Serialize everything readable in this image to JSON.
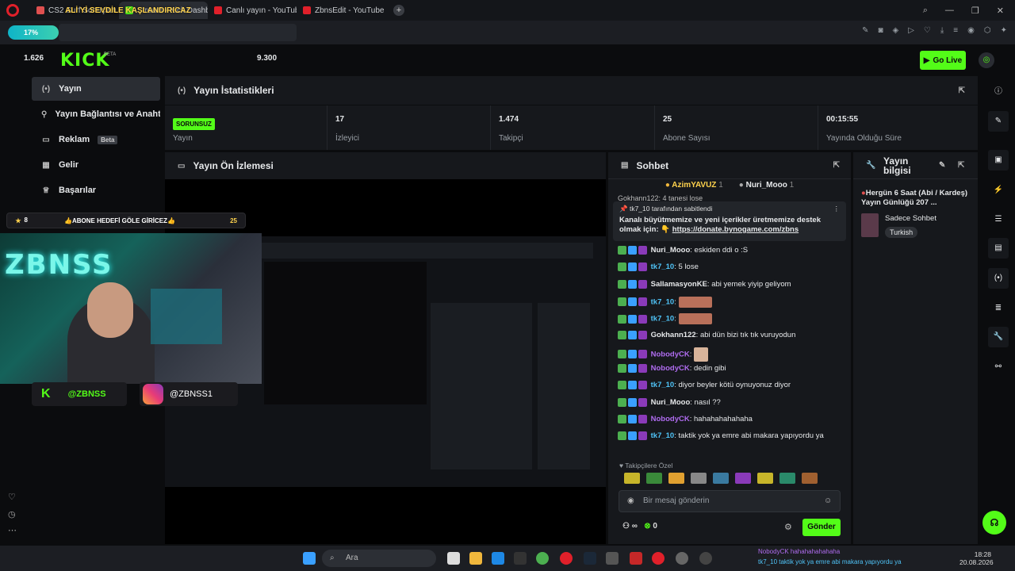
{
  "browser": {
    "tabs": [
      {
        "title": "CS2 Surf Sonuçları - xplo",
        "color": "#e05050"
      },
      {
        "title": "Stream - Kick Dashboard",
        "color": "#53fc18"
      },
      {
        "title": "Canlı yayın - YouTube Stu",
        "color": "#e0202a"
      },
      {
        "title": "ZbnsEdit - YouTube",
        "color": "#e0202a"
      }
    ],
    "banner_text": "ALİ Yİ SEVDİLE KAŞLANDIRICAZ",
    "progress_label": "17%"
  },
  "header": {
    "logo": "KICK",
    "logo_badge": "BETA",
    "left_count": "1.626",
    "right_count": "9.300",
    "go_live_label": "Go Live"
  },
  "sidebar": {
    "items": [
      {
        "label": "Yayın",
        "icon": "(•)",
        "active": true
      },
      {
        "label": "Yayın Bağlantısı ve Anahtarı",
        "icon": "⚲"
      },
      {
        "label": "Reklam",
        "icon": "▭",
        "badge": "Beta"
      },
      {
        "label": "Gelir",
        "icon": "▦"
      },
      {
        "label": "Başarılar",
        "icon": "♕"
      }
    ]
  },
  "overlay": {
    "goal_text": "👍ABONE HEDEFİ GÖLE GİRİCEZ👍",
    "goal_left": "8",
    "goal_right": "25",
    "neon_text": "ZBNSS",
    "kick_handle": "@ZBNSS",
    "ig_handle": "@ZBNSS1"
  },
  "stats": {
    "title": "Yayın İstatistikleri",
    "status_badge": "SORUNSUZ",
    "status_label": "Yayın",
    "viewers": "17",
    "viewers_label": "İzleyici",
    "followers": "1.474",
    "followers_label": "Takipçi",
    "subs": "25",
    "subs_label": "Abone Sayısı",
    "duration": "00:15:55",
    "duration_label": "Yayında Olduğu Süre"
  },
  "preview": {
    "title": "Yayın Ön İzlemesi"
  },
  "chat": {
    "title": "Sohbet",
    "top_gifters": [
      {
        "name": "AzimYAVUZ",
        "count": "1"
      },
      {
        "name": "Nuri_Mooo",
        "count": "1"
      }
    ],
    "cut_message": "Gokhann122: 4 tanesi lose",
    "pinned_by": "tk7_10 tarafından sabitlendi",
    "pinned_text": "Kanalı büyütmemize ve yeni içerikler üretmemize destek olmak için: 👇",
    "pinned_link": "https://donate.bynogame.com/zbns",
    "messages": [
      {
        "user": "Nuri_Mooo",
        "color": "#e6e8ea",
        "text": "eskiden ddi o :S"
      },
      {
        "user": "tk7_10",
        "color": "#4fc3f7",
        "text": "5 lose"
      },
      {
        "user": "SallamasyonKE",
        "color": "#e6e8ea",
        "text": "abi yemek yiyip geliyom"
      },
      {
        "user": "tk7_10",
        "color": "#4fc3f7",
        "text": "",
        "emote": true
      },
      {
        "user": "tk7_10",
        "color": "#4fc3f7",
        "text": "",
        "emote": true
      },
      {
        "user": "Gokhann122",
        "color": "#e6e8ea",
        "text": "abi dün bizi tık tık vuruyodun"
      },
      {
        "user": "NobodyCK",
        "color": "#b06cf0",
        "text": "",
        "emote_small": true
      },
      {
        "user": "NobodyCK",
        "color": "#b06cf0",
        "text": "dedin gibi"
      },
      {
        "user": "tk7_10",
        "color": "#4fc3f7",
        "text": "diyor beyler kötü oynuyonuz diyor"
      },
      {
        "user": "Nuri_Mooo",
        "color": "#e6e8ea",
        "text": "nasıl ??"
      },
      {
        "user": "NobodyCK",
        "color": "#b06cf0",
        "text": "hahahahahahaha"
      },
      {
        "user": "tk7_10",
        "color": "#4fc3f7",
        "text": "taktik yok ya emre abi makara yapıyordu ya"
      }
    ],
    "follower_only": "Takipçilere Özel",
    "input_placeholder": "Bir mesaj gönderin",
    "points": "0",
    "send_label": "Gönder"
  },
  "stream_info": {
    "title": "Yayın bilgisi",
    "stream_title": "Hergün 6 Saat (Abi / Kardeş) Yayın Günlüğü 207 ...",
    "category": "Sadece Sohbet",
    "tag": "Turkish"
  },
  "taskbar": {
    "search_placeholder": "Ara",
    "time": "18:28",
    "date": "20.08.2026",
    "toast_line1": "NobodyCK hahahahahahaha",
    "toast_line2": "tk7_10 taktik yok ya emre abi makara yapıyordu ya"
  }
}
